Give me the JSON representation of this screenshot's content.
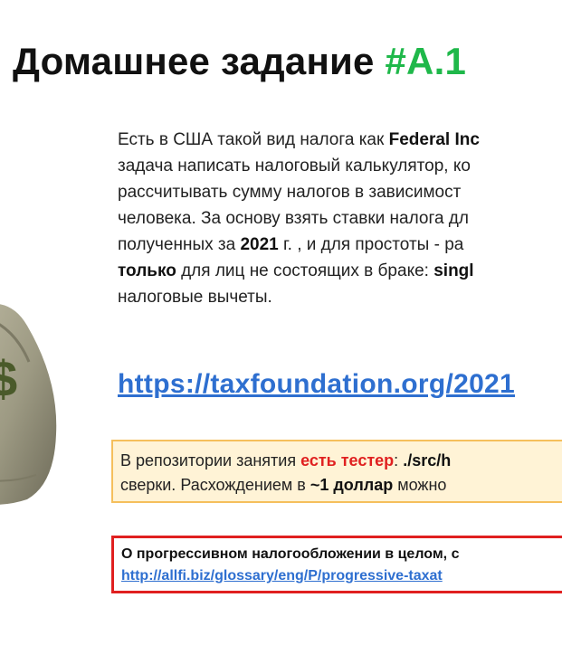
{
  "title": {
    "main": "Домашнее задание ",
    "accent": "#A.1",
    "accent_color": "#1fb84a"
  },
  "paragraph": {
    "l1_a": "Есть в США такой вид налога как ",
    "l1_b": "Federal Inc",
    "l2": "задача написать налоговый калькулятор, ко",
    "l3": "рассчитывать сумму налогов в зависимост",
    "l4": "человека. За основу взять ставки налога дл",
    "l5_a": "полученных за ",
    "l5_b": "2021",
    "l5_c": " г. , и для простоты - ра",
    "l6_a": "только",
    "l6_b": " для лиц не состоящих в браке: ",
    "l6_c": "singl",
    "l7": "налоговые вычеты."
  },
  "big_link": "https://taxfoundation.org/2021",
  "tester_box": {
    "l1_a": "В репозитории занятия ",
    "l1_b": "есть тестер",
    "l1_c": ": ",
    "l1_d": "./src/h",
    "l2_a": "сверки. Расхождением в ",
    "l2_b": "~1 доллар",
    "l2_c": " можно"
  },
  "info_box": {
    "heading": "О прогрессивном налогообложении в целом, с",
    "link": "http://allfi.biz/glossary/eng/P/progressive-taxat"
  },
  "bag_icon": {
    "symbol": "$"
  }
}
